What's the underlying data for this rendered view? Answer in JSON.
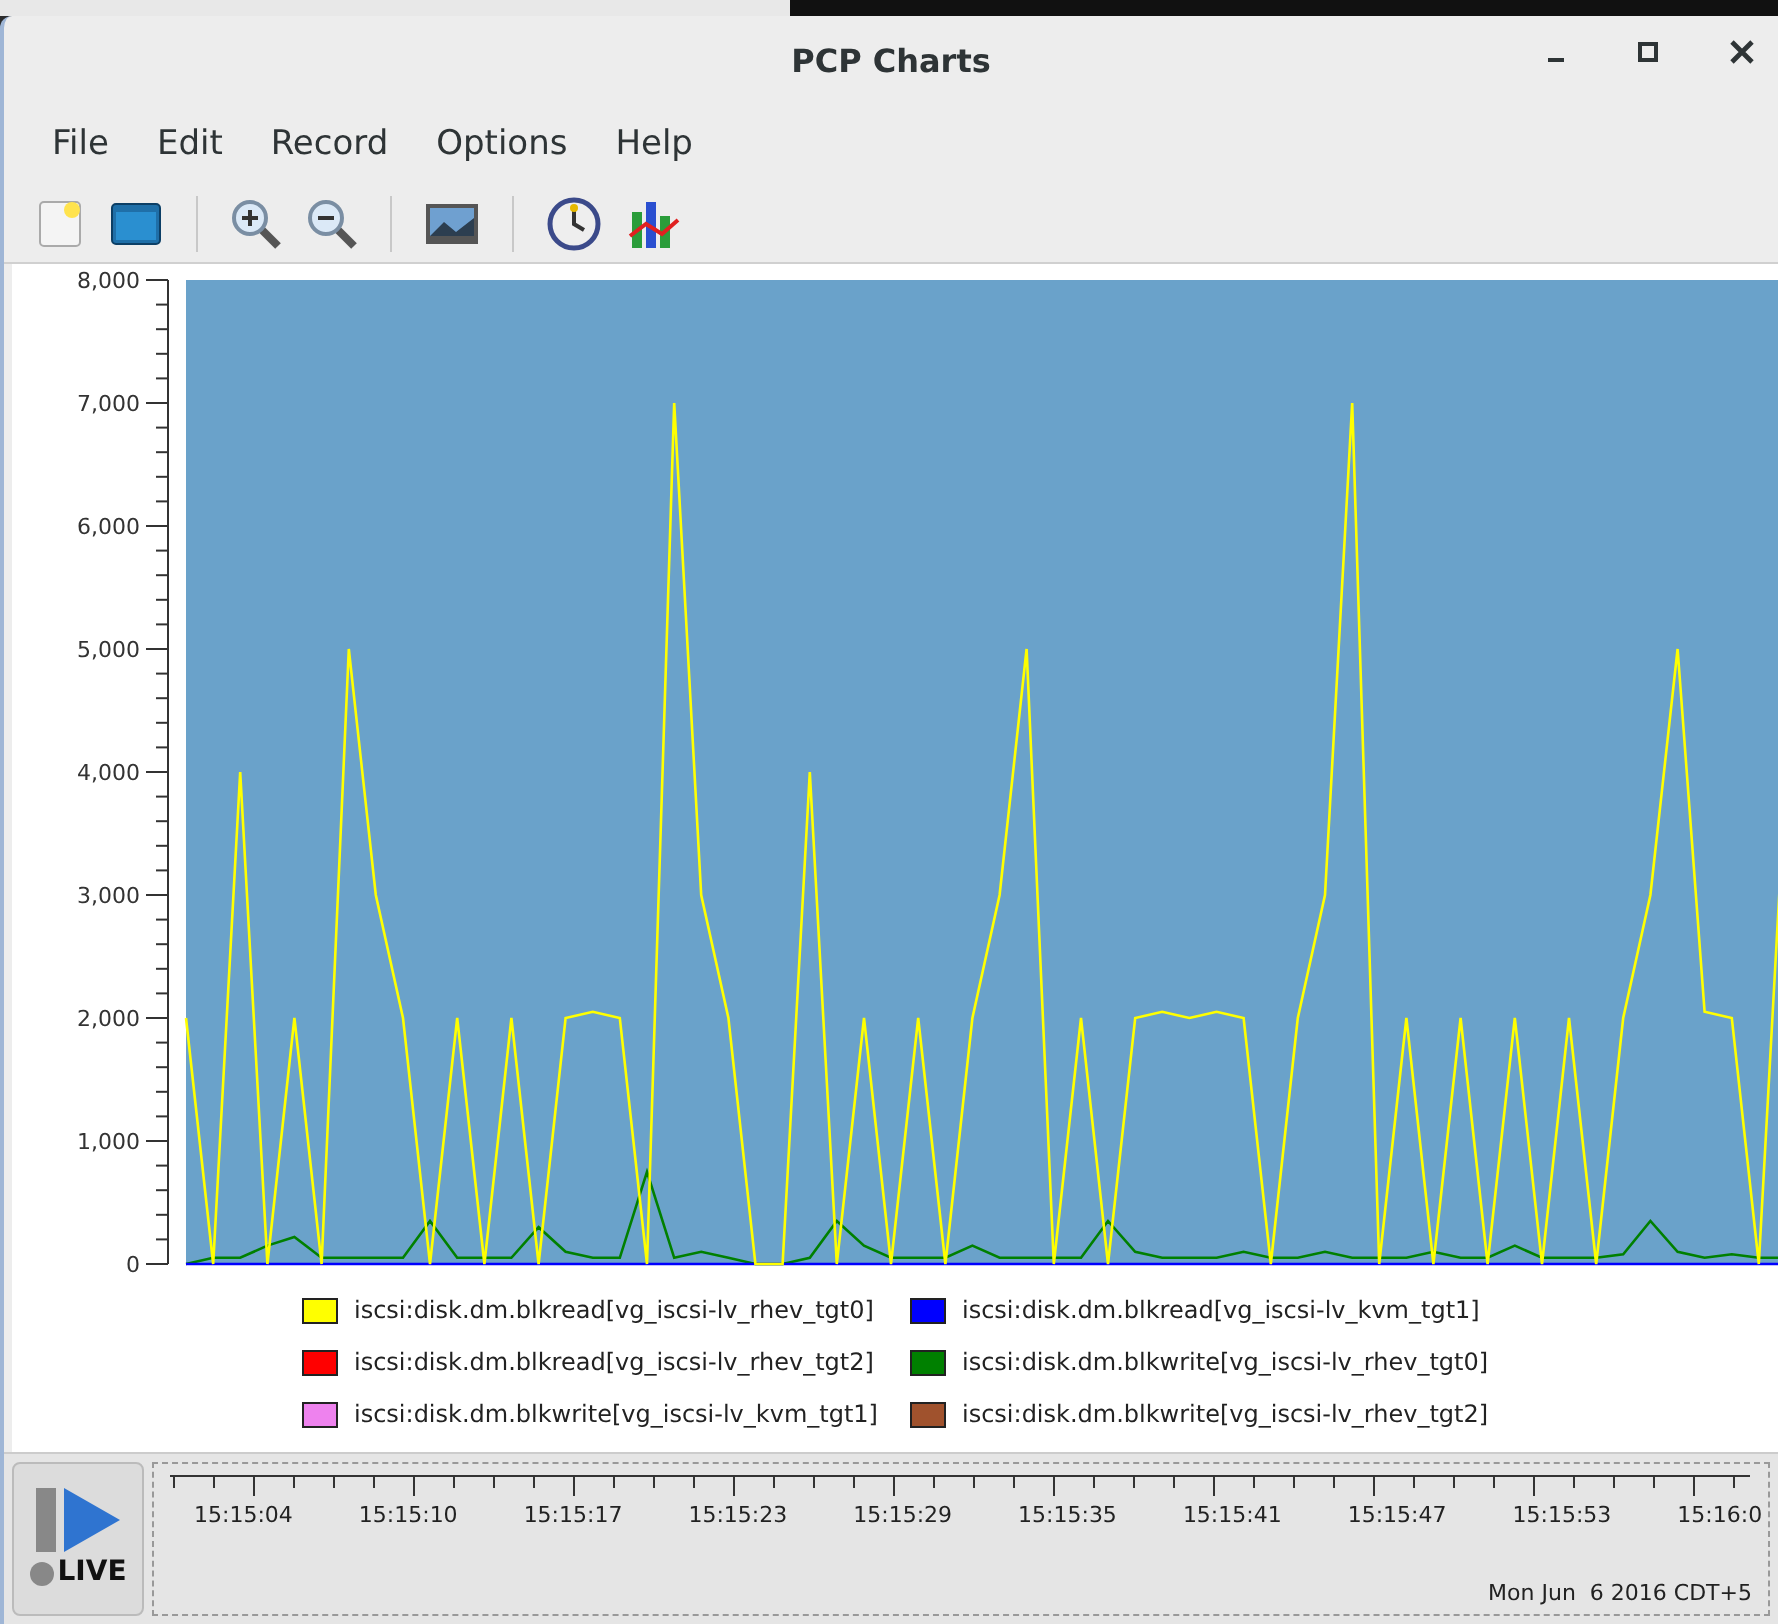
{
  "window": {
    "title": "PCP Charts"
  },
  "menu": [
    "File",
    "Edit",
    "Record",
    "Options",
    "Help"
  ],
  "toolbar": [
    {
      "kind": "new"
    },
    {
      "kind": "open"
    },
    {
      "kind": "sep"
    },
    {
      "kind": "zoom-in"
    },
    {
      "kind": "zoom-out"
    },
    {
      "kind": "sep"
    },
    {
      "kind": "image"
    },
    {
      "kind": "sep"
    },
    {
      "kind": "clock"
    },
    {
      "kind": "chart"
    }
  ],
  "chart": {
    "chart_data": {
      "type": "line",
      "ylim": [
        0,
        8000
      ],
      "yticks": [
        {
          "value": 0,
          "label": "0"
        },
        {
          "value": 1000,
          "label": "1,000"
        },
        {
          "value": 2000,
          "label": "2,000"
        },
        {
          "value": 3000,
          "label": "3,000"
        },
        {
          "value": 4000,
          "label": "4,000"
        },
        {
          "value": 5000,
          "label": "5,000"
        },
        {
          "value": 6000,
          "label": "6,000"
        },
        {
          "value": 7000,
          "label": "7,000"
        },
        {
          "value": 8000,
          "label": "8,000"
        }
      ],
      "series": [
        {
          "name": "iscsi:disk.dm.blkread[vg_iscsi-lv_rhev_tgt0]",
          "color": "#ffff00",
          "values": [
            2000,
            0,
            4000,
            0,
            2000,
            0,
            5000,
            3000,
            2000,
            0,
            2000,
            0,
            2000,
            0,
            2000,
            2050,
            2000,
            0,
            7000,
            3000,
            2000,
            0,
            0,
            4000,
            0,
            2000,
            0,
            2000,
            0,
            2000,
            3000,
            5000,
            0,
            2000,
            0,
            2000,
            2050,
            2000,
            2050,
            2000,
            0,
            2000,
            3000,
            7000,
            0,
            2000,
            0,
            2000,
            0,
            2000,
            0,
            2000,
            0,
            2000,
            3000,
            5000,
            2050,
            2000,
            0,
            4000
          ]
        },
        {
          "name": "iscsi:disk.dm.blkread[vg_iscsi-lv_kvm_tgt1]",
          "color": "#0000ff",
          "values": [
            0,
            0,
            0,
            0,
            0,
            0,
            0,
            0,
            0,
            0,
            0,
            0,
            0,
            0,
            0,
            0,
            0,
            0,
            0,
            0,
            0,
            0,
            0,
            0,
            0,
            0,
            0,
            0,
            0,
            0,
            0,
            0,
            0,
            0,
            0,
            0,
            0,
            0,
            0,
            0,
            0,
            0,
            0,
            0,
            0,
            0,
            0,
            0,
            0,
            0,
            0,
            0,
            0,
            0,
            0,
            0,
            0,
            0,
            0,
            0
          ]
        },
        {
          "name": "iscsi:disk.dm.blkread[vg_iscsi-lv_rhev_tgt2]",
          "color": "#ff0000",
          "values": [
            null,
            null,
            null,
            null,
            null,
            null,
            null,
            null,
            null,
            null,
            null,
            null,
            null,
            null,
            null,
            null,
            null,
            null,
            null,
            null,
            null,
            null,
            null,
            null,
            null,
            null,
            null,
            null,
            null,
            null,
            null,
            null,
            null,
            null,
            null,
            null,
            null,
            null,
            null,
            null,
            null,
            null,
            null,
            null,
            null,
            null,
            null,
            null,
            null,
            null,
            null,
            null,
            null,
            null,
            null,
            null,
            null,
            null,
            null,
            null
          ]
        },
        {
          "name": "iscsi:disk.dm.blkwrite[vg_iscsi-lv_rhev_tgt0]",
          "color": "#008000",
          "values": [
            0,
            50,
            50,
            150,
            220,
            50,
            50,
            50,
            50,
            350,
            50,
            50,
            50,
            300,
            100,
            50,
            50,
            750,
            50,
            100,
            50,
            0,
            0,
            50,
            350,
            150,
            50,
            50,
            50,
            150,
            50,
            50,
            50,
            50,
            350,
            100,
            50,
            50,
            50,
            100,
            50,
            50,
            100,
            50,
            50,
            50,
            100,
            50,
            50,
            150,
            50,
            50,
            50,
            80,
            350,
            100,
            50,
            80,
            50,
            50
          ]
        },
        {
          "name": "iscsi:disk.dm.blkwrite[vg_iscsi-lv_kvm_tgt1]",
          "color": "#ee82ee",
          "values": [
            null,
            null,
            null,
            null,
            null,
            null,
            null,
            null,
            null,
            null,
            null,
            null,
            null,
            null,
            null,
            null,
            null,
            null,
            null,
            null,
            null,
            null,
            null,
            null,
            null,
            null,
            null,
            null,
            null,
            null,
            null,
            null,
            null,
            null,
            null,
            null,
            null,
            null,
            null,
            null,
            null,
            null,
            null,
            null,
            null,
            null,
            null,
            null,
            null,
            null,
            null,
            null,
            null,
            null,
            null,
            null,
            null,
            null,
            null,
            null
          ]
        },
        {
          "name": "iscsi:disk.dm.blkwrite[vg_iscsi-lv_rhev_tgt2]",
          "color": "#a0522d",
          "values": [
            null,
            null,
            null,
            null,
            null,
            null,
            null,
            null,
            null,
            null,
            null,
            null,
            null,
            null,
            null,
            null,
            null,
            null,
            null,
            null,
            null,
            null,
            null,
            null,
            null,
            null,
            null,
            null,
            null,
            null,
            null,
            null,
            null,
            null,
            null,
            null,
            null,
            null,
            null,
            null,
            null,
            null,
            null,
            null,
            null,
            null,
            null,
            null,
            null,
            null,
            null,
            null,
            null,
            null,
            null,
            null,
            null,
            null,
            null,
            null
          ]
        }
      ]
    }
  },
  "live": {
    "label": "LIVE"
  },
  "timeline": {
    "ticks": [
      "15:15:04",
      "15:15:10",
      "15:15:17",
      "15:15:23",
      "15:15:29",
      "15:15:35",
      "15:15:41",
      "15:15:47",
      "15:15:53",
      "15:16:0"
    ],
    "date": "Mon Jun  6 2016 CDT+5"
  }
}
